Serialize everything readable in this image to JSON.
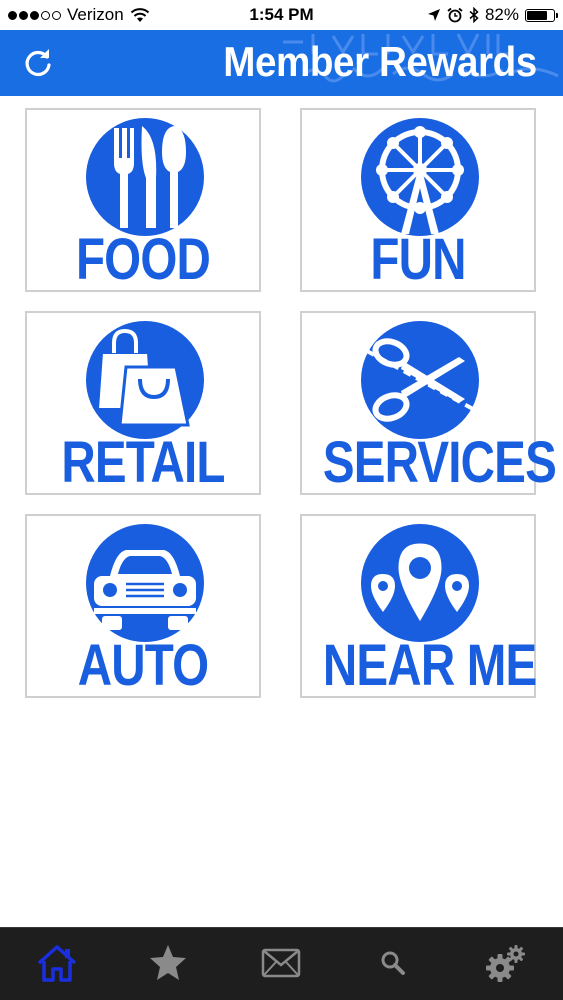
{
  "status_bar": {
    "carrier": "Verizon",
    "time": "1:54 PM",
    "battery": "82%",
    "battery_level": 0.82,
    "signal_bars_filled": 3,
    "signal_bars_total": 5,
    "icons": [
      "wifi-icon",
      "location-icon",
      "alarm-icon",
      "bluetooth-icon",
      "battery-icon"
    ]
  },
  "header": {
    "title": "Member Rewards",
    "refresh_icon": "refresh-icon",
    "background_color": "#1a6ee3"
  },
  "categories": [
    {
      "label": "FOOD",
      "icon": "utensils-icon"
    },
    {
      "label": "FUN",
      "icon": "ferris-wheel-icon"
    },
    {
      "label": "RETAIL",
      "icon": "shopping-bags-icon"
    },
    {
      "label": "SERVICES",
      "icon": "scissors-icon"
    },
    {
      "label": "AUTO",
      "icon": "car-icon"
    },
    {
      "label": "NEAR ME",
      "icon": "map-pins-icon"
    }
  ],
  "tab_bar": {
    "tabs": [
      {
        "name": "home",
        "icon": "home-icon",
        "active": true
      },
      {
        "name": "favorites",
        "icon": "star-icon",
        "active": false
      },
      {
        "name": "messages",
        "icon": "envelope-icon",
        "active": false
      },
      {
        "name": "search",
        "icon": "search-icon",
        "active": false
      },
      {
        "name": "settings",
        "icon": "gears-icon",
        "active": false
      }
    ]
  },
  "colors": {
    "accent": "#1a5ee0",
    "tile_border": "#cfcfcf",
    "tab_bar_bg": "#1e1e1e",
    "tab_icon": "#8a8a8a",
    "tab_active": "#1a2fe0"
  }
}
